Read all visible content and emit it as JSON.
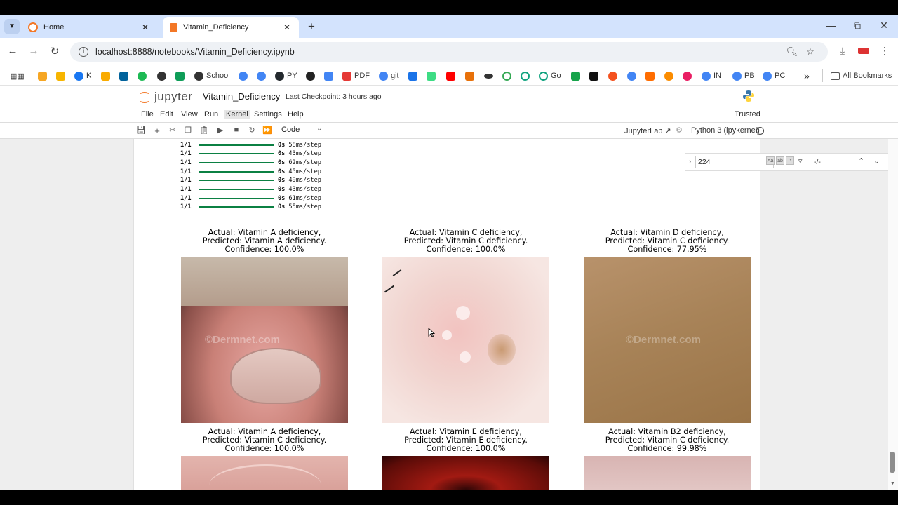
{
  "browser": {
    "tabs": [
      {
        "label": "Home",
        "active": false
      },
      {
        "label": "Vitamin_Deficiency",
        "active": true
      }
    ],
    "url": "localhost:8888/notebooks/Vitamin_Deficiency.ipynb",
    "bookmarks": [
      "K",
      "School",
      "PY",
      "PDF",
      "git",
      "Go",
      "IN",
      "PB",
      "PC"
    ],
    "all_bookmarks_label": "All Bookmarks"
  },
  "jupyter": {
    "logo_text": "jupyter",
    "notebook_title": "Vitamin_Deficiency",
    "checkpoint": "Last Checkpoint: 3 hours ago",
    "menu": [
      "File",
      "Edit",
      "View",
      "Run",
      "Kernel",
      "Settings",
      "Help"
    ],
    "active_menu": "Kernel",
    "trusted": "Trusted",
    "cell_type": "Code",
    "jupyterlab_link": "JupyterLab",
    "kernel": "Python 3 (ipykernel)"
  },
  "output": {
    "log_lines": [
      {
        "ratio": "1/1",
        "secs": "0s",
        "step": "58ms/step"
      },
      {
        "ratio": "1/1",
        "secs": "0s",
        "step": "43ms/step"
      },
      {
        "ratio": "1/1",
        "secs": "0s",
        "step": "62ms/step"
      },
      {
        "ratio": "1/1",
        "secs": "0s",
        "step": "45ms/step"
      },
      {
        "ratio": "1/1",
        "secs": "0s",
        "step": "49ms/step"
      },
      {
        "ratio": "1/1",
        "secs": "0s",
        "step": "43ms/step"
      },
      {
        "ratio": "1/1",
        "secs": "0s",
        "step": "61ms/step"
      },
      {
        "ratio": "1/1",
        "secs": "0s",
        "step": "55ms/step"
      }
    ],
    "predictions": [
      {
        "actual": "Actual: Vitamin A deficiency,",
        "predicted": "Predicted: Vitamin A deficiency.",
        "confidence": "Confidence: 100.0%",
        "watermark": "©Dermnet.com"
      },
      {
        "actual": "Actual: Vitamin C deficiency,",
        "predicted": "Predicted: Vitamin C deficiency.",
        "confidence": "Confidence: 100.0%",
        "watermark": ""
      },
      {
        "actual": "Actual: Vitamin D deficiency,",
        "predicted": "Predicted: Vitamin C deficiency.",
        "confidence": "Confidence: 77.95%",
        "watermark": "©Dermnet.com"
      },
      {
        "actual": "Actual: Vitamin A deficiency,",
        "predicted": "Predicted: Vitamin C deficiency.",
        "confidence": "Confidence: 100.0%",
        "watermark": ""
      },
      {
        "actual": "Actual: Vitamin E deficiency,",
        "predicted": "Predicted: Vitamin E deficiency.",
        "confidence": "Confidence: 100.0%",
        "watermark": ""
      },
      {
        "actual": "Actual: Vitamin B2 deficiency,",
        "predicted": "Predicted: Vitamin C deficiency.",
        "confidence": "Confidence: 99.98%",
        "watermark": ""
      }
    ]
  },
  "search": {
    "value": "224",
    "count": "-/-"
  },
  "colors": {
    "accent_orange": "#f37726",
    "progress_green": "#0b8043",
    "tabstrip": "#d3e3fd"
  }
}
